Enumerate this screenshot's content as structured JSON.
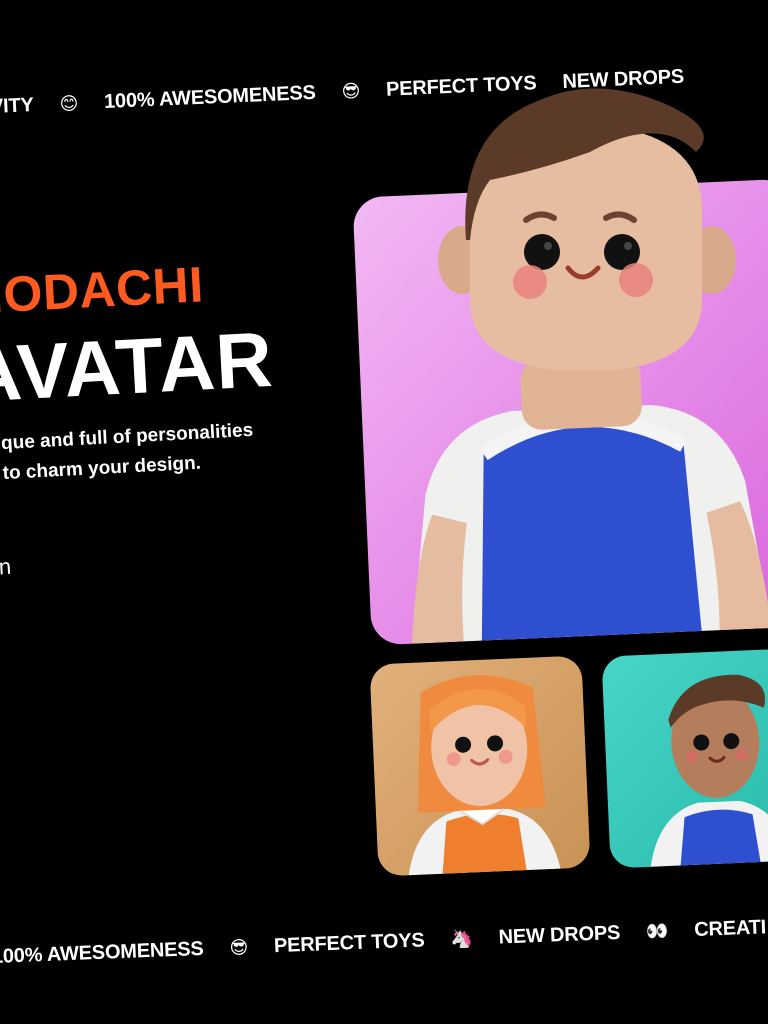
{
  "marquee_top": [
    {
      "type": "text",
      "value": "VITY"
    },
    {
      "type": "emoji",
      "value": "😊",
      "icon": "smile-emoji-icon"
    },
    {
      "type": "text",
      "value": "100% AWESOMENESS"
    },
    {
      "type": "emoji",
      "value": "😎",
      "icon": "sunglasses-emoji-icon"
    },
    {
      "type": "text",
      "value": "PERFECT TOYS"
    },
    {
      "type": "text",
      "value": "NEW DROPS"
    }
  ],
  "marquee_bottom": [
    {
      "type": "text",
      "value": "100% AWESOMENESS"
    },
    {
      "type": "emoji",
      "value": "😎",
      "icon": "sunglasses-emoji-icon"
    },
    {
      "type": "text",
      "value": "PERFECT TOYS"
    },
    {
      "type": "emoji",
      "value": "🦄",
      "icon": "unicorn-emoji-icon"
    },
    {
      "type": "text",
      "value": "NEW DROPS"
    },
    {
      "type": "emoji",
      "value": "👀",
      "icon": "eyes-emoji-icon"
    },
    {
      "type": "text",
      "value": "CREATI"
    }
  ],
  "hero": {
    "eyebrow": "MODACHI",
    "headline": "AVATAR",
    "subtitle_line1": "que and full of personalities",
    "subtitle_line2": "to charm your design.",
    "cta": "tion"
  },
  "colors": {
    "background": "#000000",
    "accent": "#ff5a1f",
    "card_main": "#e58ae8",
    "card_small_1": "#d4a066",
    "card_small_2": "#35c8b9",
    "shirt_blue": "#2f4fd1",
    "shirt_orange": "#ef7f2e"
  },
  "cards": [
    {
      "name": "boy-avatar-large",
      "icon": "boy-avatar-icon"
    },
    {
      "name": "girl-avatar",
      "icon": "girl-avatar-icon"
    },
    {
      "name": "boy-avatar-small",
      "icon": "boy-avatar-icon"
    }
  ]
}
